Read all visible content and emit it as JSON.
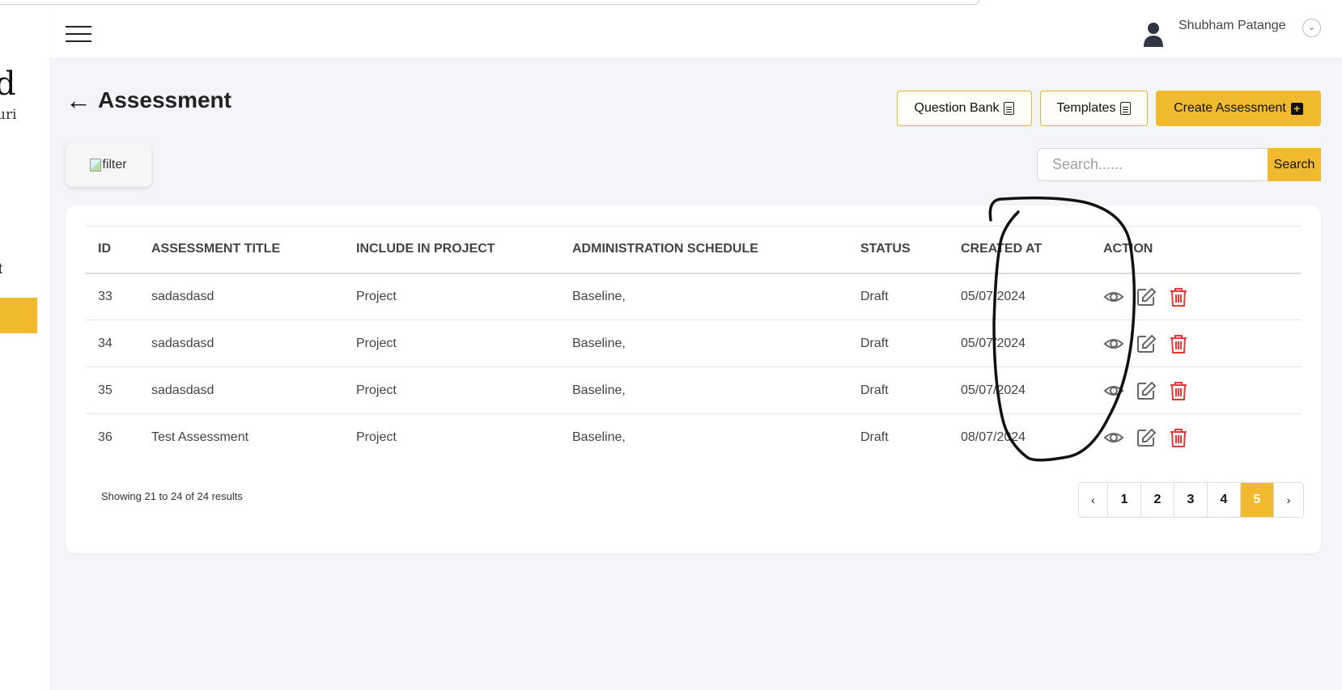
{
  "sidebar": {
    "logo_big": "d",
    "logo_small": "uri",
    "item_text": "t"
  },
  "header": {
    "user_name": "Shubham Patange",
    "chevron": "⌄"
  },
  "page": {
    "back_icon": "←",
    "title": "Assessment"
  },
  "toolbar": {
    "question_bank": "Question Bank",
    "templates": "Templates",
    "create": "Create Assessment",
    "plus": "+"
  },
  "filter": {
    "alt": "filter"
  },
  "search": {
    "placeholder": "Search......",
    "button": "Search"
  },
  "table": {
    "columns": [
      "ID",
      "ASSESSMENT TITLE",
      "INCLUDE IN PROJECT",
      "ADMINISTRATION SCHEDULE",
      "STATUS",
      "CREATED AT",
      "ACTION"
    ],
    "rows": [
      {
        "id": "33",
        "title": "sadasdasd",
        "project": "Project",
        "schedule": "Baseline,",
        "status": "Draft",
        "created": "05/07/2024"
      },
      {
        "id": "34",
        "title": "sadasdasd",
        "project": "Project",
        "schedule": "Baseline,",
        "status": "Draft",
        "created": "05/07/2024"
      },
      {
        "id": "35",
        "title": "sadasdasd",
        "project": "Project",
        "schedule": "Baseline,",
        "status": "Draft",
        "created": "05/07/2024"
      },
      {
        "id": "36",
        "title": "Test Assessment",
        "project": "Project",
        "schedule": "Baseline,",
        "status": "Draft",
        "created": "08/07/2024"
      }
    ],
    "action_icons": [
      "eye-icon",
      "edit-icon",
      "trash-icon"
    ]
  },
  "footer": {
    "results": "Showing 21 to 24 of 24 results",
    "pages": [
      "‹",
      "1",
      "2",
      "3",
      "4",
      "5",
      "›"
    ],
    "active_page": "5"
  },
  "colors": {
    "accent": "#f0b92f",
    "danger": "#e53935",
    "background": "#f4f5f8"
  }
}
